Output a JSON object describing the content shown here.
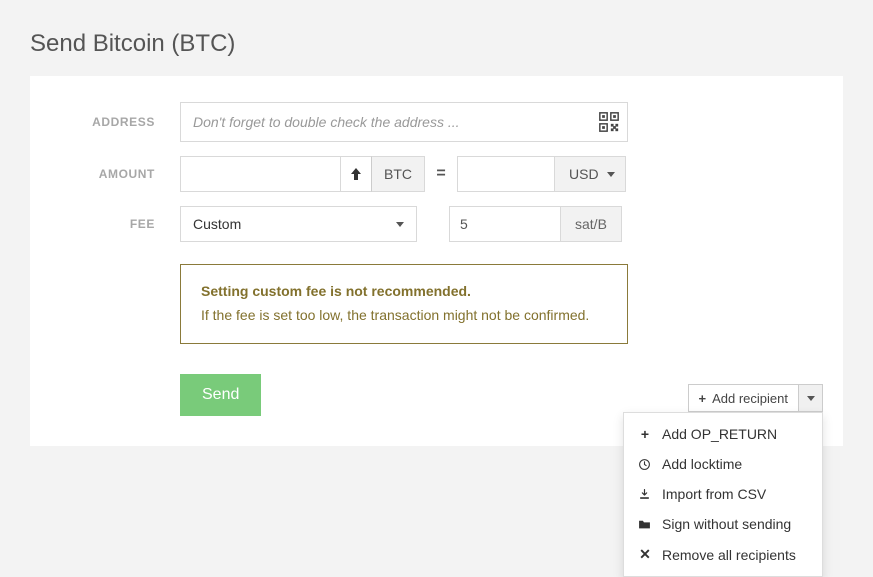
{
  "page_title": "Send Bitcoin (BTC)",
  "labels": {
    "address": "ADDRESS",
    "amount": "AMOUNT",
    "fee": "FEE"
  },
  "address": {
    "placeholder": "Don't forget to double check the address ..."
  },
  "amount": {
    "btc_value": "",
    "btc_unit": "BTC",
    "equals": "=",
    "usd_value": "",
    "usd_unit": "USD"
  },
  "fee": {
    "mode": "Custom",
    "value": "5",
    "unit": "sat/B"
  },
  "warning": {
    "title": "Setting custom fee is not recommended.",
    "body": "If the fee is set too low, the transaction might not be confirmed."
  },
  "actions": {
    "send": "Send",
    "add_recipient": "Add recipient"
  },
  "dropdown": {
    "items": [
      {
        "icon": "plus",
        "label": "Add OP_RETURN"
      },
      {
        "icon": "clock",
        "label": "Add locktime"
      },
      {
        "icon": "import",
        "label": "Import from CSV"
      },
      {
        "icon": "folder",
        "label": "Sign without sending"
      },
      {
        "icon": "x",
        "label": "Remove all recipients"
      }
    ]
  }
}
